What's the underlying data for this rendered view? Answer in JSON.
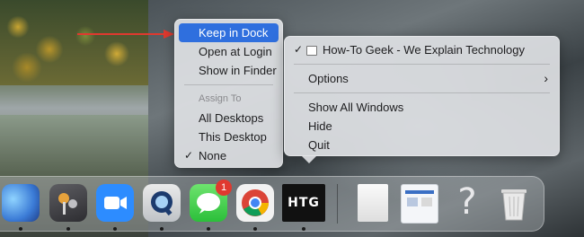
{
  "left_menu": {
    "items": [
      {
        "label": "Keep in Dock"
      },
      {
        "label": "Open at Login"
      },
      {
        "label": "Show in Finder"
      }
    ],
    "assign_header": "Assign To",
    "assign_items": [
      {
        "label": "All Desktops"
      },
      {
        "label": "This Desktop"
      },
      {
        "label": "None",
        "checked": true
      }
    ]
  },
  "right_menu": {
    "window_item": "How-To Geek - We Explain Technology",
    "options_label": "Options",
    "items": [
      "Show All Windows",
      "Hide",
      "Quit"
    ]
  },
  "dock": {
    "apps": [
      {
        "name": "tweaks-app-icon"
      },
      {
        "name": "keychain-app-icon"
      },
      {
        "name": "zoom-app-icon"
      },
      {
        "name": "quicktime-app-icon"
      },
      {
        "name": "messages-app-icon",
        "badge": "1"
      },
      {
        "name": "chrome-app-icon"
      },
      {
        "name": "htg-app-icon",
        "label": "HTG"
      },
      {
        "name": "document-icon"
      },
      {
        "name": "screenshot-icon"
      },
      {
        "name": "question-mark-icon",
        "glyph": "?"
      },
      {
        "name": "trash-icon"
      }
    ]
  },
  "colors": {
    "highlight": "#2f6fde",
    "arrow": "#e0392f"
  }
}
